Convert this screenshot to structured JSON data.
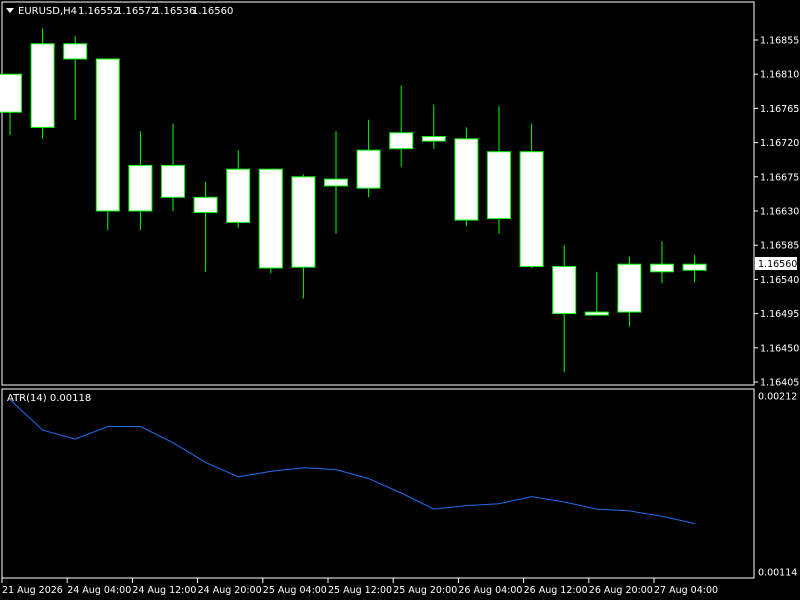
{
  "header": {
    "symbol_label": "EURUSD,H4",
    "open": "1.16552",
    "high": "1.16572",
    "low": "1.16536",
    "close": "1.16560"
  },
  "atr_label": "ATR(14) 0.00118",
  "current_price_tag": "1.16560",
  "colors": {
    "background": "#000000",
    "frame": "#ffffff",
    "candle_body": "#ffffff",
    "candle_outline": "#00ff00",
    "atr_line": "#1e6ef0"
  },
  "chart_data": [
    {
      "type": "candlestick",
      "title": "EURUSD,H4",
      "ylim": [
        1.16385,
        1.16885
      ],
      "y_ticks": [
        "1.16855",
        "1.16810",
        "1.16765",
        "1.16720",
        "1.16675",
        "1.16630",
        "1.16585",
        "1.16540",
        "1.16495",
        "1.16450",
        "1.16405"
      ],
      "grid": false,
      "candles": [
        {
          "o": 1.1676,
          "h": 1.1679,
          "l": 1.1673,
          "c": 1.1681
        },
        {
          "o": 1.1674,
          "h": 1.1687,
          "l": 1.16725,
          "c": 1.1685
        },
        {
          "o": 1.1685,
          "h": 1.1686,
          "l": 1.1675,
          "c": 1.1683
        },
        {
          "o": 1.1683,
          "h": 1.1683,
          "l": 1.16605,
          "c": 1.1663
        },
        {
          "o": 1.1663,
          "h": 1.16735,
          "l": 1.16605,
          "c": 1.1669
        },
        {
          "o": 1.1669,
          "h": 1.16745,
          "l": 1.1663,
          "c": 1.16648
        },
        {
          "o": 1.16648,
          "h": 1.16668,
          "l": 1.1655,
          "c": 1.16628
        },
        {
          "o": 1.16615,
          "h": 1.1671,
          "l": 1.16608,
          "c": 1.16685
        },
        {
          "o": 1.16685,
          "h": 1.16685,
          "l": 1.16548,
          "c": 1.16555
        },
        {
          "o": 1.16556,
          "h": 1.16678,
          "l": 1.16515,
          "c": 1.16675
        },
        {
          "o": 1.16663,
          "h": 1.16735,
          "l": 1.166,
          "c": 1.16672
        },
        {
          "o": 1.1666,
          "h": 1.1675,
          "l": 1.16648,
          "c": 1.1671
        },
        {
          "o": 1.16712,
          "h": 1.16795,
          "l": 1.16688,
          "c": 1.16733
        },
        {
          "o": 1.16722,
          "h": 1.1677,
          "l": 1.16712,
          "c": 1.16728
        },
        {
          "o": 1.16725,
          "h": 1.1674,
          "l": 1.1661,
          "c": 1.16618
        },
        {
          "o": 1.1662,
          "h": 1.16768,
          "l": 1.166,
          "c": 1.16708
        },
        {
          "o": 1.16708,
          "h": 1.16745,
          "l": 1.16555,
          "c": 1.16557
        },
        {
          "o": 1.16557,
          "h": 1.16585,
          "l": 1.16418,
          "c": 1.16495
        },
        {
          "o": 1.16493,
          "h": 1.1655,
          "l": 1.16493,
          "c": 1.16497
        },
        {
          "o": 1.16497,
          "h": 1.1657,
          "l": 1.16478,
          "c": 1.1656
        },
        {
          "o": 1.1656,
          "h": 1.1659,
          "l": 1.16535,
          "c": 1.1655
        },
        {
          "o": 1.16552,
          "h": 1.16572,
          "l": 1.16536,
          "c": 1.1656
        }
      ]
    },
    {
      "type": "line",
      "title": "ATR(14) 0.00118",
      "ylim": [
        0.00114,
        0.00212
      ],
      "y_ticks": [
        "0.00212",
        "0.00114"
      ],
      "series": [
        {
          "values": [
            0.0021,
            0.00193,
            0.00188,
            0.00195,
            0.00195,
            0.00186,
            0.00175,
            0.00167,
            0.0017,
            0.00172,
            0.00171,
            0.00166,
            0.00158,
            0.00149,
            0.00151,
            0.00152,
            0.00156,
            0.00153,
            0.00149,
            0.00148,
            0.00145,
            0.00141
          ]
        }
      ]
    }
  ],
  "x_axis": {
    "labels": [
      "21 Aug 2026",
      "24 Aug 04:00",
      "24 Aug 12:00",
      "24 Aug 20:00",
      "25 Aug 04:00",
      "25 Aug 12:00",
      "25 Aug 20:00",
      "26 Aug 04:00",
      "26 Aug 12:00",
      "26 Aug 20:00",
      "27 Aug 04:00"
    ]
  }
}
